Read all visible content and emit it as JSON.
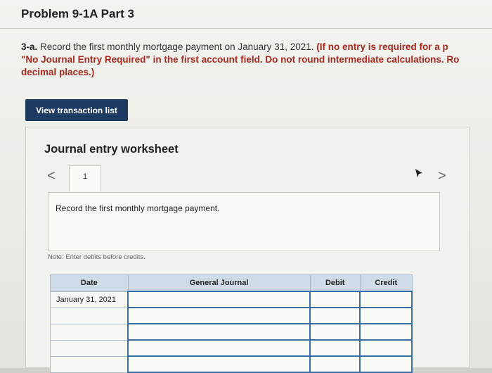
{
  "problem": {
    "title": "Problem 9-1A Part 3",
    "instruction_lead": "3-a.",
    "instruction_text": " Record the first monthly mortgage payment on January 31, 2021. ",
    "instruction_bold_1": "(If no entry is required for a p",
    "instruction_line2": "\"No Journal Entry Required\" in the first account field. Do not round intermediate calculations. Ro",
    "instruction_line3": "decimal places.)"
  },
  "buttons": {
    "view_transactions": "View transaction list"
  },
  "worksheet": {
    "title": "Journal entry worksheet",
    "nav_prev": "<",
    "nav_next": ">",
    "active_tab": "1",
    "record_prompt": "Record the first monthly mortgage payment.",
    "note": "Note: Enter debits before credits."
  },
  "journal_table": {
    "headers": {
      "date": "Date",
      "general_journal": "General Journal",
      "debit": "Debit",
      "credit": "Credit"
    },
    "rows": [
      {
        "date": "January 31, 2021",
        "account": "",
        "debit": "",
        "credit": ""
      },
      {
        "date": "",
        "account": "",
        "debit": "",
        "credit": ""
      },
      {
        "date": "",
        "account": "",
        "debit": "",
        "credit": ""
      },
      {
        "date": "",
        "account": "",
        "debit": "",
        "credit": ""
      },
      {
        "date": "",
        "account": "",
        "debit": "",
        "credit": ""
      }
    ]
  },
  "colors": {
    "button_bg": "#1d3a63",
    "header_bg": "#cfdbe9",
    "input_border": "#3a6ea5"
  }
}
